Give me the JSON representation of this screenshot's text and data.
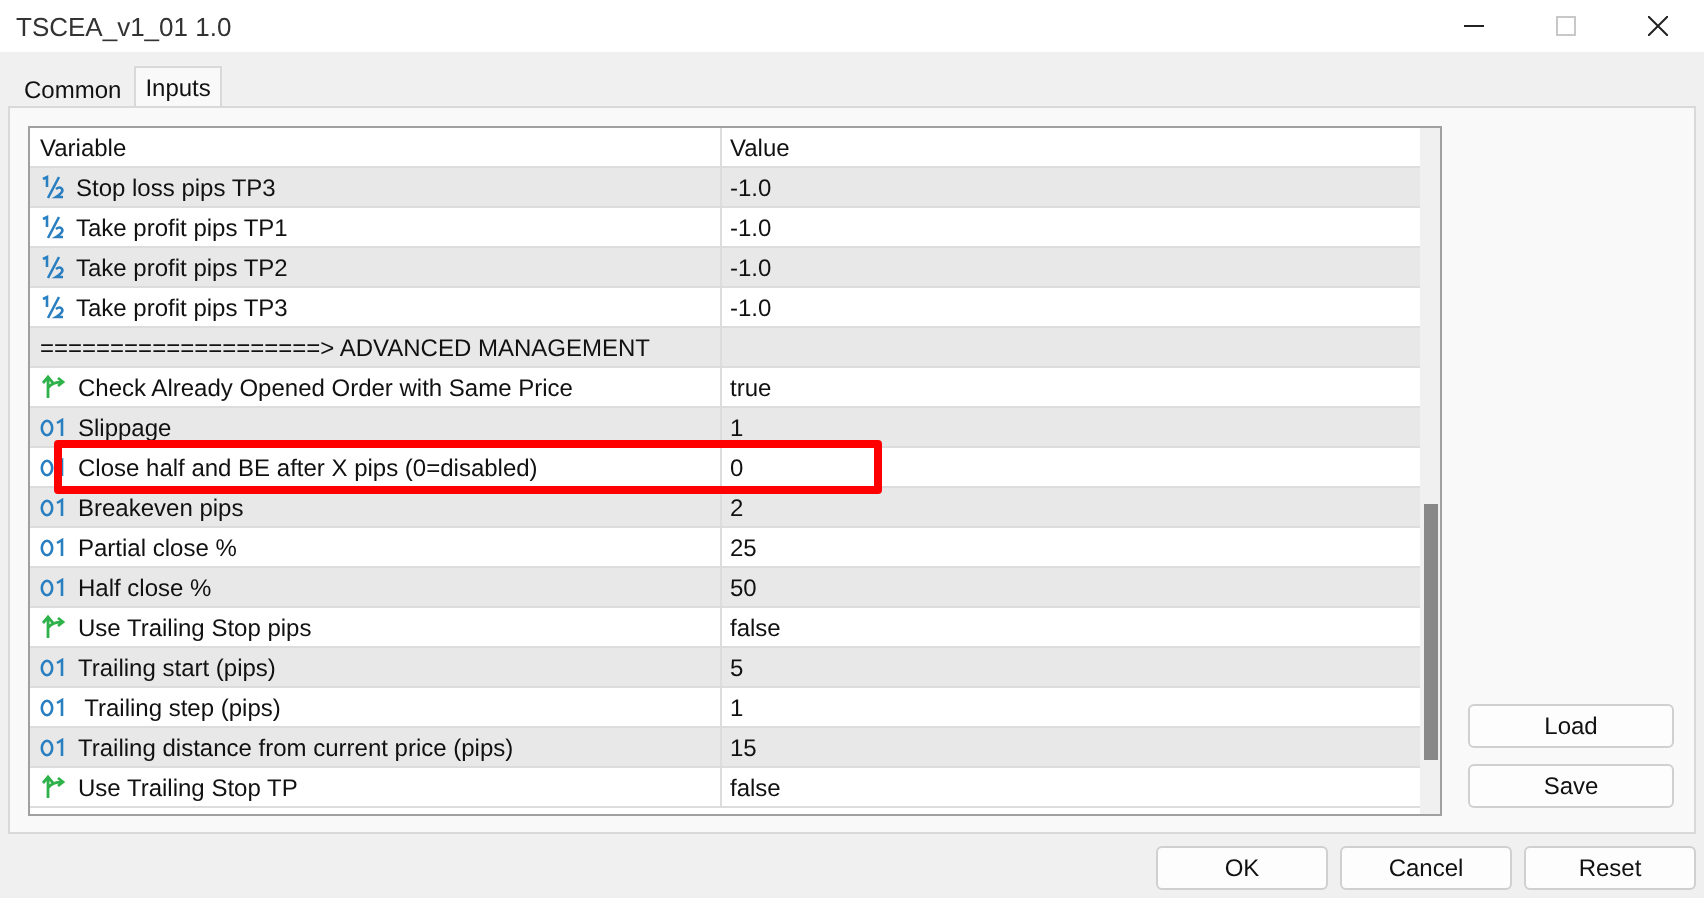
{
  "window": {
    "title": "TSCEA_v1_01 1.0"
  },
  "tabs": [
    {
      "label": "Common",
      "selected": false
    },
    {
      "label": "Inputs",
      "selected": true
    }
  ],
  "table": {
    "columns": [
      "Variable",
      "Value"
    ],
    "rows": [
      {
        "kind": "double",
        "variable": "Stop loss pips TP3",
        "value": "-1.0",
        "highlighted": false
      },
      {
        "kind": "double",
        "variable": "Take profit pips TP1",
        "value": "-1.0",
        "highlighted": false
      },
      {
        "kind": "double",
        "variable": "Take profit pips TP2",
        "value": "-1.0",
        "highlighted": false
      },
      {
        "kind": "double",
        "variable": "Take profit pips TP3",
        "value": "-1.0",
        "highlighted": false
      },
      {
        "kind": "separator",
        "variable": "====================> ADVANCED MANAGEMENT",
        "value": "",
        "highlighted": false
      },
      {
        "kind": "bool",
        "variable": "Check Already Opened Order with Same Price",
        "value": "true",
        "highlighted": false
      },
      {
        "kind": "int",
        "variable": "Slippage",
        "value": "1",
        "highlighted": false
      },
      {
        "kind": "int",
        "variable": "Close half and BE after X pips (0=disabled)",
        "value": "0",
        "highlighted": true
      },
      {
        "kind": "int",
        "variable": "Breakeven pips",
        "value": "2",
        "highlighted": false
      },
      {
        "kind": "int",
        "variable": "Partial close %",
        "value": "25",
        "highlighted": false
      },
      {
        "kind": "int",
        "variable": "Half close %",
        "value": "50",
        "highlighted": false
      },
      {
        "kind": "bool",
        "variable": "Use Trailing Stop pips",
        "value": "false",
        "highlighted": false
      },
      {
        "kind": "int",
        "variable": "Trailing start (pips)",
        "value": "5",
        "highlighted": false
      },
      {
        "kind": "int",
        "variable": " Trailing step (pips)",
        "value": "1",
        "highlighted": false
      },
      {
        "kind": "int",
        "variable": "Trailing distance from current price (pips)",
        "value": "15",
        "highlighted": false
      },
      {
        "kind": "bool",
        "variable": "Use Trailing Stop TP",
        "value": "false",
        "highlighted": false
      }
    ]
  },
  "side_buttons": [
    "Load",
    "Save"
  ],
  "buttons": [
    "OK",
    "Cancel",
    "Reset"
  ]
}
